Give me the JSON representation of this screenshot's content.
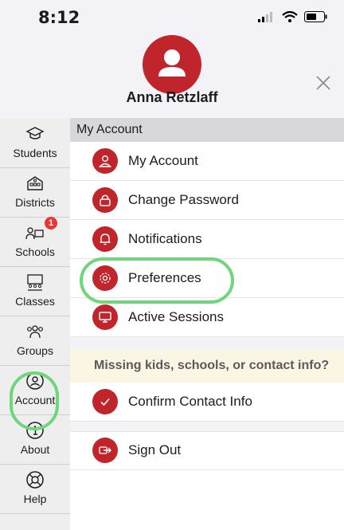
{
  "status": {
    "time": "8:12"
  },
  "header": {
    "user_name": "Anna Retzlaff"
  },
  "sidebar": {
    "items": [
      {
        "label": "Students"
      },
      {
        "label": "Districts"
      },
      {
        "label": "Schools",
        "badge": "1"
      },
      {
        "label": "Classes"
      },
      {
        "label": "Groups"
      },
      {
        "label": "Account",
        "selected": true
      },
      {
        "label": "About"
      },
      {
        "label": "Help"
      }
    ]
  },
  "main": {
    "section_title": "My Account",
    "rows": [
      {
        "label": "My Account",
        "icon": "user-icon"
      },
      {
        "label": "Change Password",
        "icon": "lock-icon"
      },
      {
        "label": "Notifications",
        "icon": "bell-icon"
      },
      {
        "label": "Preferences",
        "icon": "gear-icon"
      },
      {
        "label": "Active Sessions",
        "icon": "monitor-icon"
      }
    ],
    "banner": "Missing kids, schools, or contact info?",
    "confirm_label": "Confirm Contact Info",
    "signout_label": "Sign Out"
  },
  "colors": {
    "accent": "#c0252b",
    "highlight": "#6fd67a",
    "banner_bg": "#fbf5e4"
  }
}
